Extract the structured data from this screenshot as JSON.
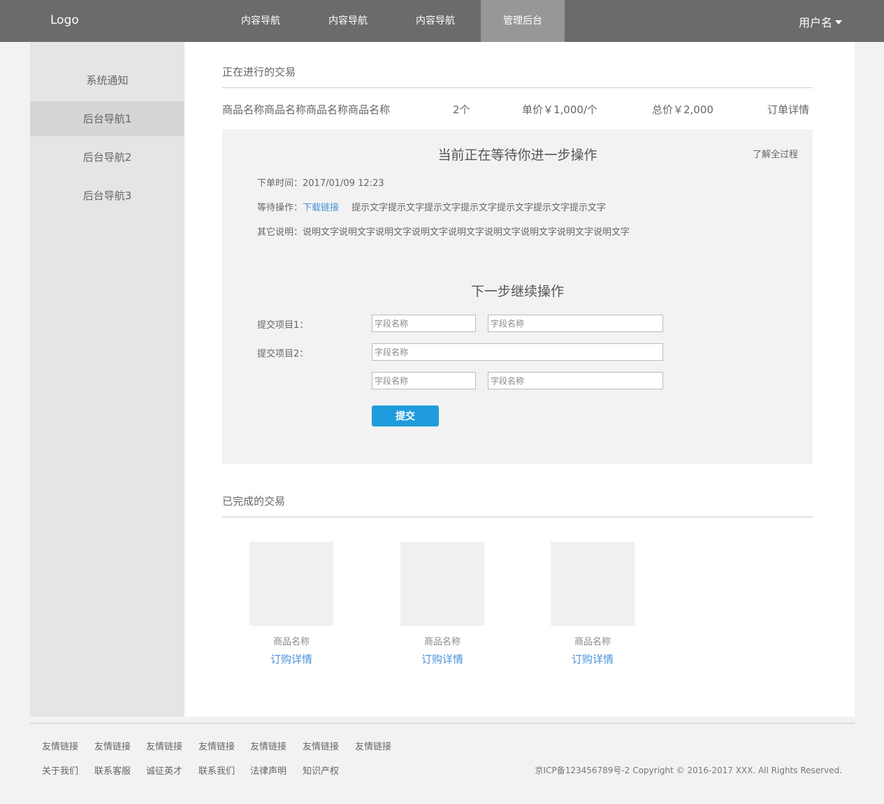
{
  "header": {
    "logo": "Logo",
    "nav": [
      {
        "label": "内容导航"
      },
      {
        "label": "内容导航"
      },
      {
        "label": "内容导航"
      },
      {
        "label": "管理后台"
      }
    ],
    "user": "用户名"
  },
  "sidebar": {
    "items": [
      {
        "label": "系统通知"
      },
      {
        "label": "后台导航1"
      },
      {
        "label": "后台导航2"
      },
      {
        "label": "后台导航3"
      }
    ]
  },
  "ongoing": {
    "title": "正在进行的交易",
    "order": {
      "name": "商品名称商品名称商品名称商品名称",
      "qty": "2个",
      "unit_price": "单价￥1,000/个",
      "total": "总价￥2,000",
      "detail_link": "订单详情"
    },
    "panel": {
      "title": "当前正在等待你进一步操作",
      "learn_link": "了解全过程",
      "order_time_label": "下单时间：",
      "order_time": "2017/01/09  12:23",
      "wait_label": "等待操作：",
      "download_link": "下载链接",
      "hint": "提示文字提示文字提示文字提示文字提示文字提示文字提示文字",
      "other_label": "其它说明：",
      "other_text": "说明文字说明文字说明文字说明文字说明文字说明文字说明文字说明文字说明文字"
    },
    "form": {
      "title": "下一步继续操作",
      "item1_label": "提交项目1：",
      "item2_label": "提交项目2：",
      "placeholder": "字段名称",
      "submit": "提交"
    }
  },
  "completed": {
    "title": "已完成的交易",
    "cards": [
      {
        "name": "商品名称",
        "link": "订购详情"
      },
      {
        "name": "商品名称",
        "link": "订购详情"
      },
      {
        "name": "商品名称",
        "link": "订购详情"
      }
    ]
  },
  "footer": {
    "friend_links": [
      "友情链接",
      "友情链接",
      "友情链接",
      "友情链接",
      "友情链接",
      "友情链接",
      "友情链接"
    ],
    "info_links": [
      "关于我们",
      "联系客服",
      "诚征英才",
      "联系我们",
      "法律声明",
      "知识产权"
    ],
    "copyright": "京ICP备123456789号-2 Copyright © 2016-2017 XXX. All Rights Reserved."
  },
  "colors": {
    "topbar": "#6b6b6b",
    "nav_active": "#979797",
    "link": "#4a90d9",
    "button": "#1e9bdc"
  }
}
